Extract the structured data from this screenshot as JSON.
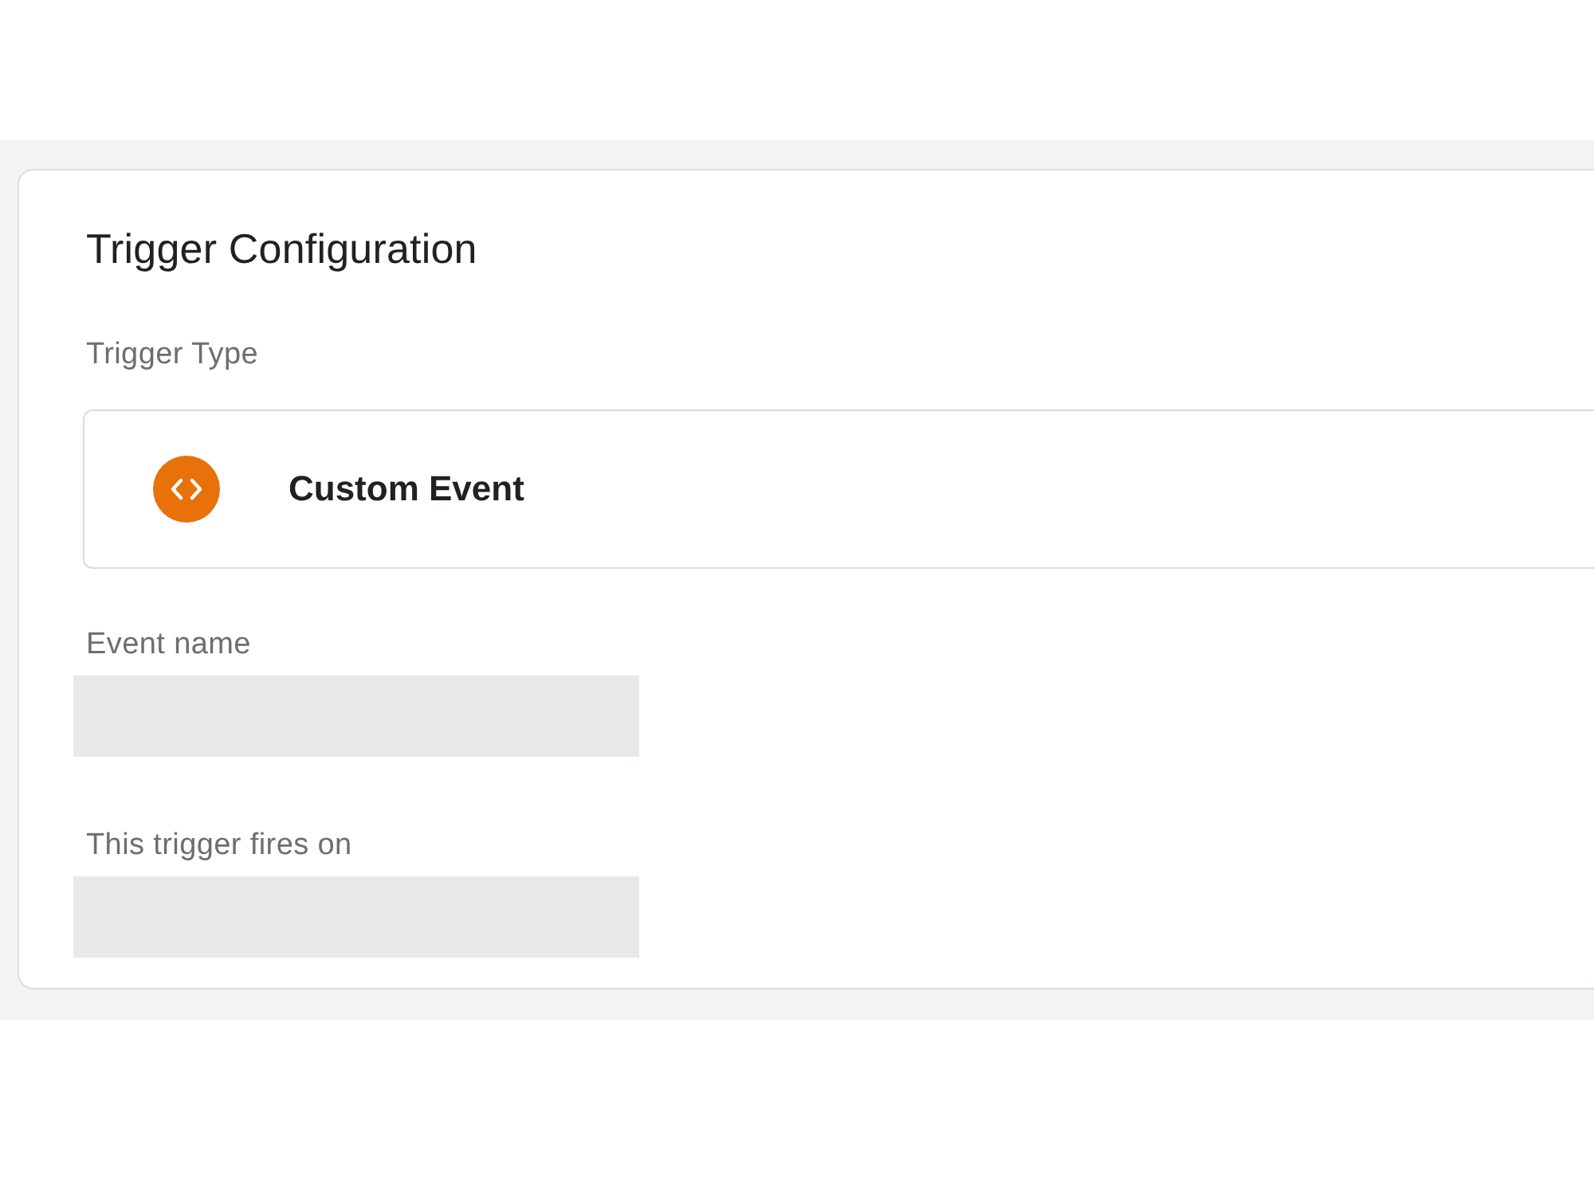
{
  "card": {
    "title": "Trigger Configuration",
    "trigger_type": {
      "label": "Trigger Type",
      "value": "Custom Event"
    },
    "fields": [
      {
        "label": "Event name"
      },
      {
        "label": "This trigger fires on"
      }
    ]
  }
}
